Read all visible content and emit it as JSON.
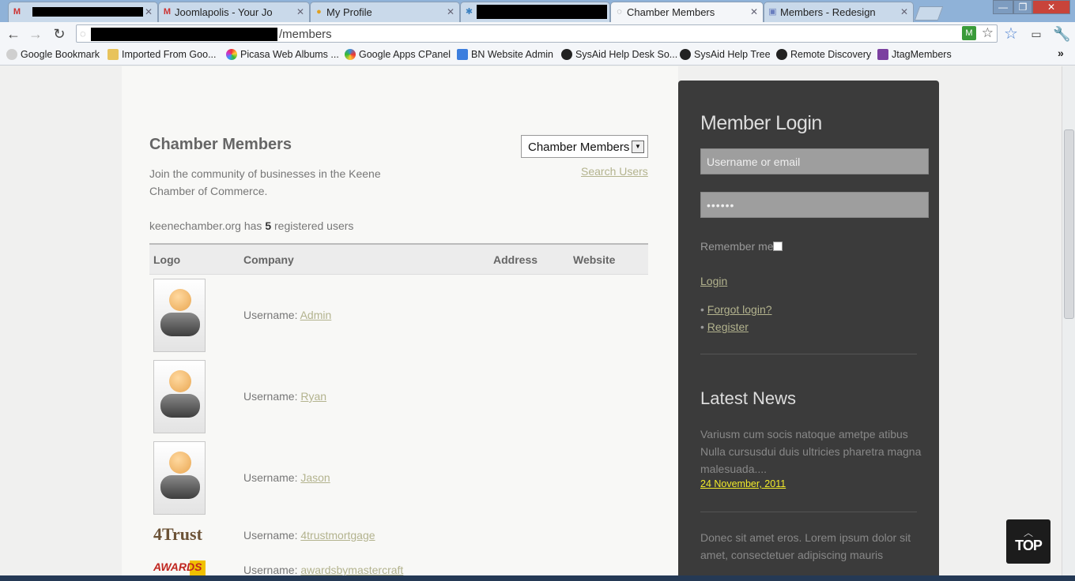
{
  "browser": {
    "tabs": [
      {
        "title": "",
        "icon": "gmail-icon",
        "redacted": true
      },
      {
        "title": "Joomlapolis - Your Jo",
        "icon": "gmail-icon"
      },
      {
        "title": "My Profile",
        "icon": "profile-icon"
      },
      {
        "title": "",
        "icon": "joomla-icon",
        "redacted": true
      },
      {
        "title": "Chamber Members",
        "icon": "page-icon",
        "active": true
      },
      {
        "title": "Members - Redesign",
        "icon": "page-icon"
      }
    ],
    "address": "/members",
    "bookmarks": [
      {
        "label": "Google Bookmark",
        "color": "#d0d0d0"
      },
      {
        "label": "Imported From Goo...",
        "color": "#e8c35c"
      },
      {
        "label": "Picasa Web Albums ...",
        "color": "#c84fbf"
      },
      {
        "label": "Google Apps CPanel",
        "color": "#3c8ede"
      },
      {
        "label": "BN Website Admin",
        "color": "#3c7ede"
      },
      {
        "label": "SysAid Help Desk So...",
        "color": "#333333"
      },
      {
        "label": "SysAid Help Tree",
        "color": "#333333"
      },
      {
        "label": "Remote Discovery",
        "color": "#333333"
      },
      {
        "label": "JtagMembers",
        "color": "#7b3fa0"
      }
    ]
  },
  "members": {
    "title": "Chamber Members",
    "intro": "Join the community of businesses in the Keene Chamber of Commerce.",
    "count_prefix": "keenechamber.org has ",
    "count": "5",
    "count_suffix": " registered users",
    "list_select": "Chamber Members",
    "search_link": "Search Users",
    "columns": [
      "Logo",
      "Company",
      "Address",
      "Website"
    ],
    "username_label": "Username: ",
    "rows": [
      {
        "username": "Admin",
        "logo": "default-avatar"
      },
      {
        "username": "Ryan",
        "logo": "default-avatar"
      },
      {
        "username": "Jason",
        "logo": "default-avatar"
      },
      {
        "username": "4trustmortgage",
        "logo": "4trust-logo",
        "logo_text": "4Trust"
      },
      {
        "username": "awardsbymastercraft",
        "logo": "awards-logo",
        "logo_text": "AWARDS"
      }
    ]
  },
  "sidebar": {
    "login_title": "Member Login",
    "username_placeholder": "Username or email",
    "password_value": "••••••",
    "remember_label": "Remember me",
    "login_link": "Login",
    "links": [
      "Forgot login?",
      "Register"
    ],
    "news_title": "Latest News",
    "news": [
      {
        "text": "Varius​m cum socis natoque ametpe atibus Nulla cursusdui duis ultricies pharetra magna malesuada....",
        "date": "24 November, 2011"
      },
      {
        "text": "Donec sit amet eros. Lorem ipsum dolor sit amet, consectetuer adipiscing mauris"
      }
    ]
  },
  "top_button": "TOP"
}
